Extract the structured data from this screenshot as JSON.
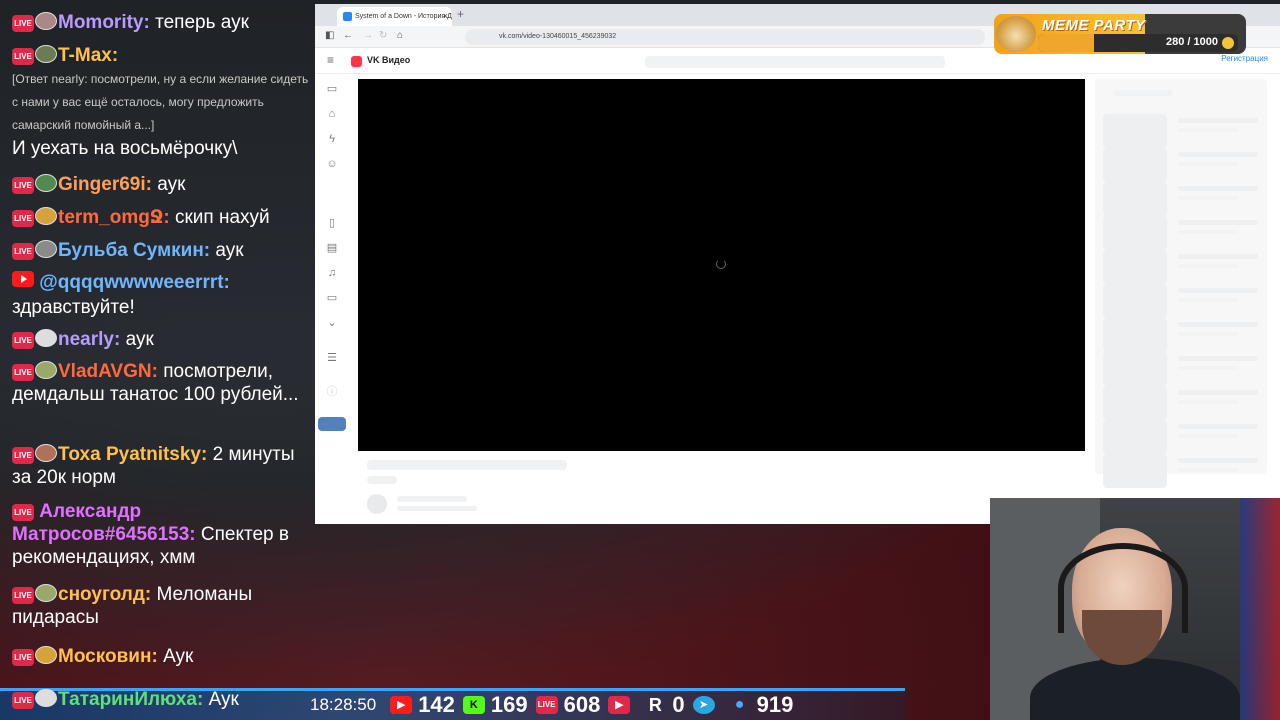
{
  "chat": {
    "messages": [
      {
        "badge": "live",
        "nick": "Momority:",
        "nick_color": "#b79bff",
        "text": "теперь аук"
      },
      {
        "badge": "live",
        "nick": "T-Max:",
        "nick_color": "#ffc04d",
        "quote": "[Ответ nearly: посмотрели, ну а если желание сидеть с нами у вас ещё осталось, могу предложить самарский помойный а...]",
        "text": "И уехать на восьмёрочку\\"
      },
      {
        "badge": "live",
        "nick": "Ginger69i:",
        "nick_color": "#ff9f5a",
        "text": "аук"
      },
      {
        "badge": "live",
        "nick": "term_omgՋ:",
        "nick_color": "#ff6a3d",
        "text": "скип нахуй"
      },
      {
        "badge": "live",
        "nick": "Бульба Сумкин:",
        "nick_color": "#6fb6ff",
        "text": "аук"
      },
      {
        "badge": "youtube",
        "nick": "@qqqqwwwweeerrrt:",
        "nick_color": "#6fb6ff",
        "text": "здравствуйте!"
      },
      {
        "badge": "live",
        "nick": "nearly:",
        "nick_color": "#b79bff",
        "text": "аук"
      },
      {
        "badge": "live",
        "nick": "VladAVGN:",
        "nick_color": "#ff6a3d",
        "text": "посмотрели, демдальш танатос 100 рублей..."
      },
      {
        "badge": "live",
        "nick": "Тоха Pyatnitsky:",
        "nick_color": "#ffc04d",
        "text": "2 минуты за 20к норм"
      },
      {
        "badge": "live",
        "nick": "Александр Матросов#6456153:",
        "nick_color": "#e070ff",
        "text": "Спектер в рекомендациях, хмм"
      },
      {
        "badge": "live",
        "nick": "сноуголд:",
        "nick_color": "#ffc04d",
        "text": "Меломаны пидарасы"
      },
      {
        "badge": "live",
        "nick": "Московин:",
        "nick_color": "#ffc04d",
        "text": "Аук"
      },
      {
        "badge": "live",
        "nick": "ТатаринИлюха:",
        "nick_color": "#5fe07a",
        "text": "Аук"
      }
    ],
    "live_label": "LIVE"
  },
  "browser": {
    "tab_title": "System of a Down - История Д",
    "url": "vk.com/video-130460015_456239032",
    "site_name": "VK Видео",
    "register_link": "Регистрация"
  },
  "overlay": {
    "meme_title": "MEME PARTY",
    "meme_count": "280 / 1000",
    "meme_progress": 0.28
  },
  "stats": {
    "clock": "18:28:50",
    "youtube": "142",
    "kick": "169",
    "vklive": "608",
    "vkplay": "",
    "rutube": "0",
    "telegram": "",
    "viewers": "919",
    "colors": {
      "youtube": "#ff1b1b",
      "kick": "#53fc18",
      "vklive": "#e0284a",
      "rutube": "#1b1b2e",
      "telegram": "#2aa6e0",
      "viewers": "#4aa8ff"
    }
  }
}
